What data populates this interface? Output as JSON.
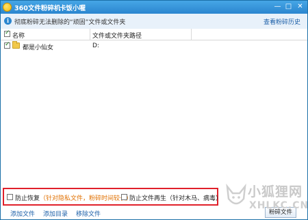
{
  "window": {
    "title": "360文件粉碎机",
    "subtitle": "卡饭小喔",
    "controls": {
      "minimize": "—",
      "maximize": "□",
      "close": "✕"
    }
  },
  "info": {
    "text": "彻底粉碎无法删除的“顽固”文件或文件夹",
    "history_link": "查看粉碎历史"
  },
  "table": {
    "headers": {
      "name": "名称",
      "path": "文件或文件夹路径"
    },
    "rows": [
      {
        "name": "都是小仙女",
        "path": "D:",
        "checked": true
      }
    ]
  },
  "options": {
    "prevent_restore": "防止恢复",
    "prevent_restore_note": "（针对隐私文件，粉碎时间较长）",
    "prevent_regen": "防止文件再生（针对木马、病毒）"
  },
  "bottom": {
    "add_file": "添加文件",
    "add_dir": "添加目录",
    "remove_file": "移除文件",
    "shred_button": "粉碎文件"
  },
  "watermark": {
    "cn": "小狐狸网",
    "en": "XHLKC.CN"
  }
}
